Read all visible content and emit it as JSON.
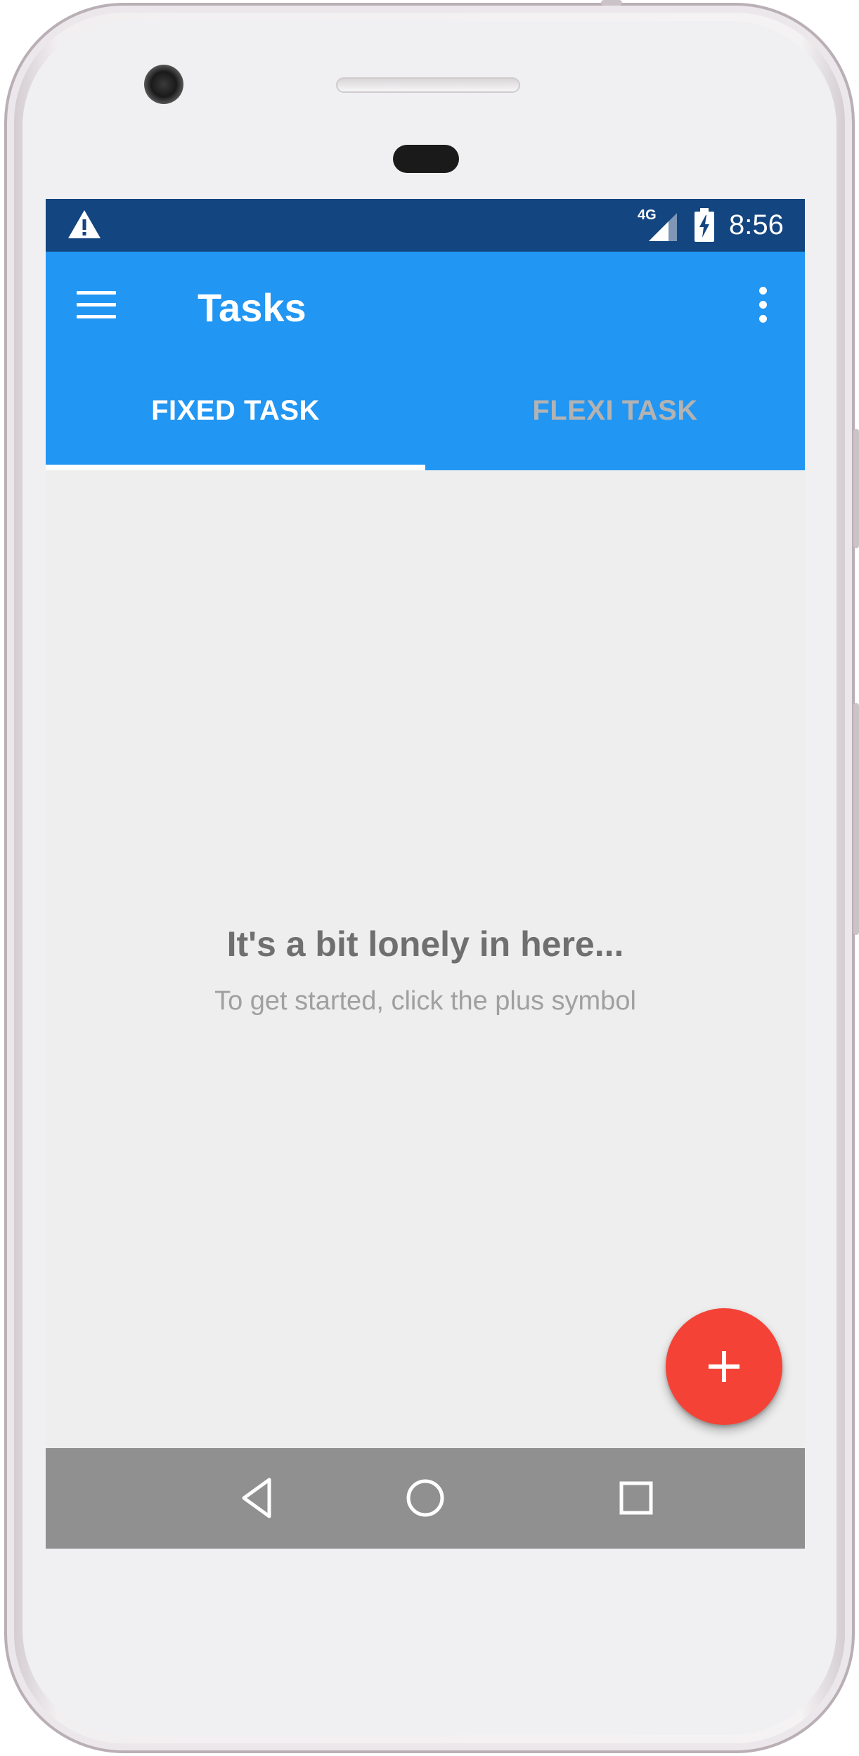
{
  "status_bar": {
    "icons": [
      "warning-icon",
      "signal-icon",
      "battery-charging-icon"
    ],
    "network": "4G",
    "time": "8:56"
  },
  "app_bar": {
    "title": "Tasks",
    "icons": [
      "menu-icon",
      "more-vert-icon"
    ]
  },
  "tabs": [
    {
      "label": "FIXED TASK",
      "selected": true
    },
    {
      "label": "FLEXI TASK",
      "selected": false
    }
  ],
  "empty_state": {
    "title": "It's a bit lonely in here...",
    "subtitle": "To get started, click the plus symbol"
  },
  "fab": {
    "icon": "plus-icon"
  },
  "nav_bar": {
    "icons": [
      "back-icon",
      "home-icon",
      "recents-icon"
    ]
  },
  "colors": {
    "status_bar": "#134580",
    "app_bar": "#2196f3",
    "background": "#eeeeee",
    "fab": "#f44336",
    "nav_bar": "#909090",
    "empty_title": "#6f6f6f",
    "empty_subtitle": "#a0a0a0",
    "tab_inactive": "#b3b3b3"
  }
}
